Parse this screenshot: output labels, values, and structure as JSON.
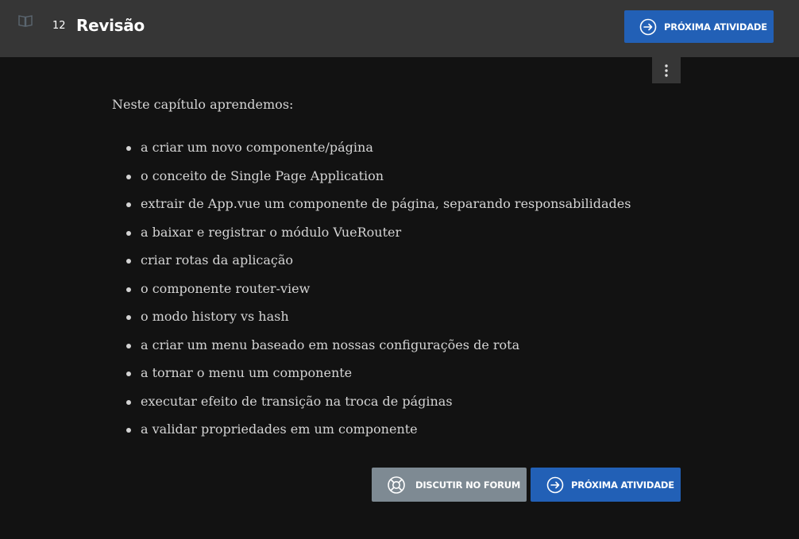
{
  "header": {
    "icon": "book-icon",
    "lesson_number": "12",
    "lesson_title": "Revisão",
    "next_label": "PRÓXIMA ATIVIDADE"
  },
  "menu": {
    "icon": "more-vertical-icon"
  },
  "content": {
    "intro": "Neste capítulo aprendemos:",
    "items": [
      "a criar um novo componente/página",
      "o conceito de Single Page Application",
      "extrair de App.vue um componente de página, separando responsabilidades",
      "a baixar e registrar o módulo VueRouter",
      "criar rotas da aplicação",
      "o componente router-view",
      "o modo history vs hash",
      "a criar um menu baseado em nossas configurações de rota",
      "a tornar o menu um componente",
      "executar efeito de transição na troca de páginas",
      "a validar propriedades em um componente"
    ]
  },
  "footer": {
    "forum_label": "DISCUTIR NO FORUM",
    "next_label": "PRÓXIMA ATIVIDADE"
  },
  "colors": {
    "topbar": "#363636",
    "background": "#121212",
    "primary": "#2260b6",
    "secondary": "#7e8a93"
  }
}
